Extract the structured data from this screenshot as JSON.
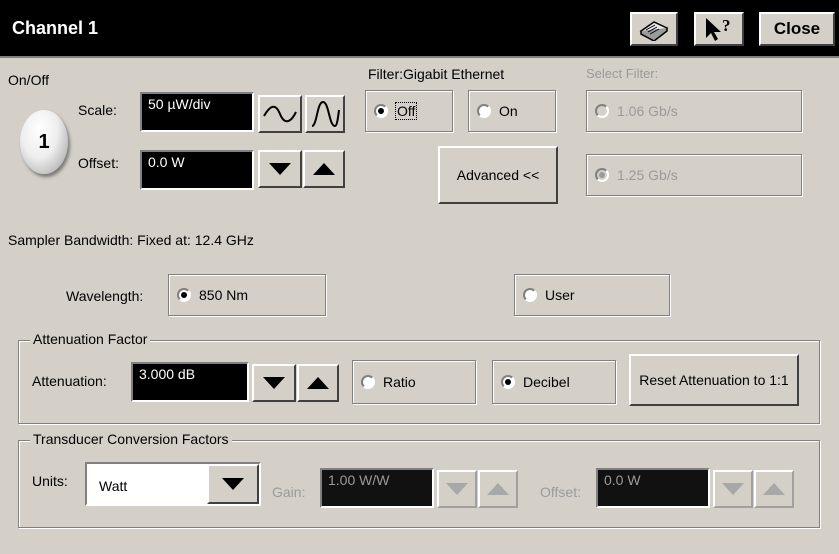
{
  "window": {
    "title": "Channel 1",
    "close_label": "Close"
  },
  "channel": {
    "onoff_label": "On/Off",
    "button_number": "1",
    "scale_label": "Scale:",
    "scale_value": "50 µW/div",
    "offset_label": "Offset:",
    "offset_value": "0.0 W"
  },
  "filter": {
    "label": "Filter:Gigabit Ethernet",
    "off_label": "Off",
    "on_label": "On",
    "selected": "Off",
    "advanced_label": "Advanced <<",
    "select_label": "Select Filter:",
    "option_1": "1.06 Gb/s",
    "option_2": "1.25 Gb/s"
  },
  "sampler_bandwidth": "Sampler Bandwidth: Fixed at: 12.4 GHz",
  "wavelength": {
    "label": "Wavelength:",
    "option_850": "850 Nm",
    "option_user": "User",
    "selected": "850 Nm"
  },
  "attenuation": {
    "group_title": "Attenuation Factor",
    "label": "Attenuation:",
    "value": "3.000 dB",
    "ratio_label": "Ratio",
    "decibel_label": "Decibel",
    "selected": "Decibel",
    "reset_label": "Reset Attenuation to 1:1"
  },
  "transducer": {
    "group_title": "Transducer Conversion Factors",
    "units_label": "Units:",
    "units_value": "Watt",
    "gain_label": "Gain:",
    "gain_value": "1.00 W/W",
    "offset_label": "Offset:",
    "offset_value": "0.0 W"
  },
  "icons": [
    "help-book-icon",
    "whats-this-icon",
    "sine-wave-icon",
    "zoomed-sine-wave-icon",
    "arrow-down-icon",
    "arrow-up-icon"
  ]
}
